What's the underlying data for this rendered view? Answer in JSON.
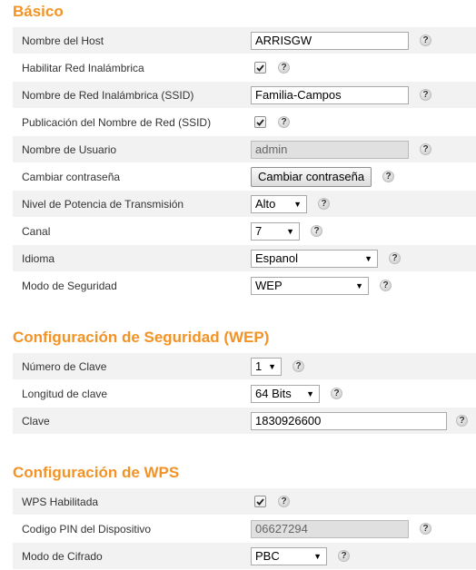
{
  "basic": {
    "title": "Básico",
    "host_name_label": "Nombre del Host",
    "host_name_value": "ARRISGW",
    "enable_wireless_label": "Habilitar Red Inalámbrica",
    "ssid_label": "Nombre de Red Inalámbrica (SSID)",
    "ssid_value": "Familia-Campos",
    "broadcast_ssid_label": "Publicación del Nombre de Red (SSID)",
    "username_label": "Nombre de Usuario",
    "username_value": "admin",
    "change_password_label": "Cambiar contraseña",
    "change_password_button": "Cambiar contraseña",
    "tx_power_label": "Nivel de Potencia de Transmisión",
    "tx_power_value": "Alto",
    "channel_label": "Canal",
    "channel_value": "7",
    "language_label": "Idioma",
    "language_value": "Espanol",
    "security_mode_label": "Modo de Seguridad",
    "security_mode_value": "WEP"
  },
  "wep": {
    "title": "Configuración de Seguridad (WEP)",
    "key_number_label": "Número de Clave",
    "key_number_value": "1",
    "key_length_label": "Longitud de clave",
    "key_length_value": "64 Bits",
    "key_label": "Clave",
    "key_value": "1830926600"
  },
  "wps": {
    "title": "Configuración de WPS",
    "enabled_label": "WPS Habilitada",
    "pin_label": "Codigo PIN del Dispositivo",
    "pin_value": "06627294",
    "encryption_mode_label": "Modo de Cifrado",
    "encryption_mode_value": "PBC"
  },
  "help_glyph": "?",
  "dropdown_arrow": "▼",
  "colors": {
    "accent": "#f39325",
    "row_alt": "#f2f2f2"
  },
  "icons": {
    "help": "help-icon",
    "checkmark": "checkmark-icon",
    "arrow": "dropdown-arrow-icon"
  }
}
